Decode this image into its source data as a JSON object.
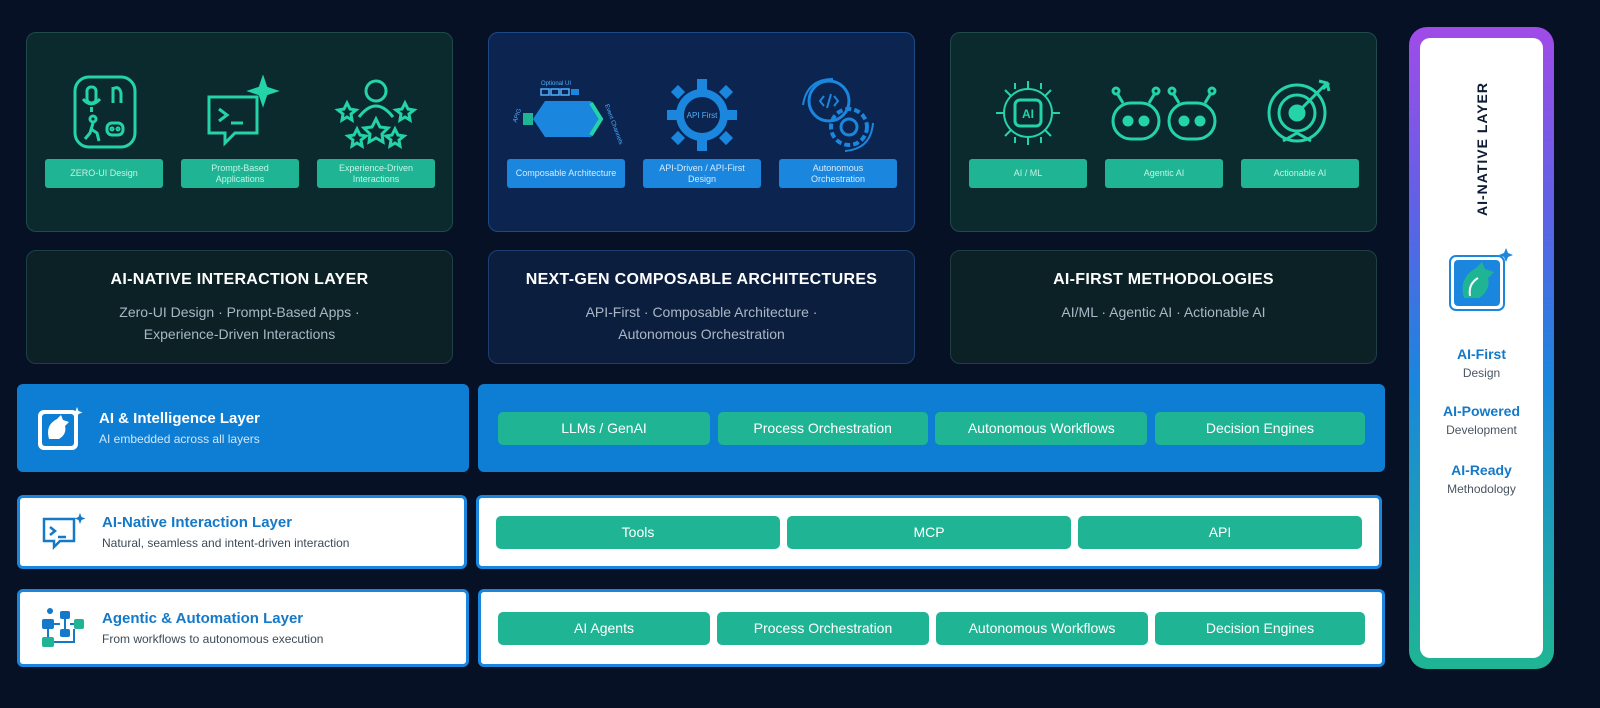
{
  "top_panels": [
    {
      "items": [
        {
          "label": "ZERO-UI Design",
          "icon": "zero-ui-icon"
        },
        {
          "label": "Prompt-Based Applications",
          "icon": "prompt-chat-icon"
        },
        {
          "label": "Experience-Driven Interactions",
          "icon": "experience-stars-icon"
        }
      ]
    },
    {
      "items": [
        {
          "label": "Composable Architecture",
          "icon": "composable-architecture-icon"
        },
        {
          "label": "API-Driven / API-First Design",
          "icon": "api-first-gear-icon"
        },
        {
          "label": "Autonomous Orchestration",
          "icon": "orchestration-gears-icon"
        }
      ],
      "composable_labels": {
        "optional_ui": "Optional UI",
        "apig": "APIG",
        "event_channels": "Event Channels"
      },
      "gear_text": "API First"
    },
    {
      "items": [
        {
          "label": "AI / ML",
          "icon": "ai-chip-icon"
        },
        {
          "label": "Agentic AI",
          "icon": "agentic-robot-icon"
        },
        {
          "label": "Actionable AI",
          "icon": "target-arrow-icon"
        }
      ],
      "chip_text": "AI"
    }
  ],
  "desc_panels": [
    {
      "title": "AI-NATIVE INTERACTION LAYER",
      "line1": "Zero-UI Design · Prompt-Based Apps ·",
      "line2": "Experience-Driven Interactions"
    },
    {
      "title": "NEXT-GEN COMPOSABLE ARCHITECTURES",
      "line1": "API-First · Composable Architecture ·",
      "line2": "Autonomous Orchestration"
    },
    {
      "title": "AI-FIRST METHODOLOGIES",
      "line1": "AI/ML · Agentic AI · Actionable AI",
      "line2": ""
    }
  ],
  "layers": [
    {
      "title": "AI & Intelligence Layer",
      "subtitle": "AI embedded across all layers",
      "icon": "ai-fox-logo-icon",
      "items": [
        "LLMs / GenAI",
        "Process Orchestration",
        "Autonomous Workflows",
        "Decision Engines"
      ]
    },
    {
      "title": "AI-Native Interaction Layer",
      "subtitle": "Natural, seamless and intent-driven interaction",
      "icon": "terminal-chat-icon",
      "items": [
        "Tools",
        "MCP",
        "API"
      ]
    },
    {
      "title": "Agentic & Automation Layer",
      "subtitle": "From workflows to autonomous execution",
      "icon": "workflow-icon",
      "items": [
        "AI Agents",
        "Process Orchestration",
        "Autonomous Workflows",
        "Decision Engines"
      ]
    }
  ],
  "sidebar": {
    "title": "AI-NATIVE LAYER",
    "logo_icon": "ai-fox-logo-icon",
    "items": [
      {
        "strong": "AI-First",
        "small": "Design"
      },
      {
        "strong": "AI-Powered",
        "small": "Development"
      },
      {
        "strong": "AI-Ready",
        "small": "Methodology"
      }
    ]
  },
  "colors": {
    "background": "#061125",
    "teal": "#1fb594",
    "blue": "#1a86dd",
    "purple": "#a14be8"
  }
}
